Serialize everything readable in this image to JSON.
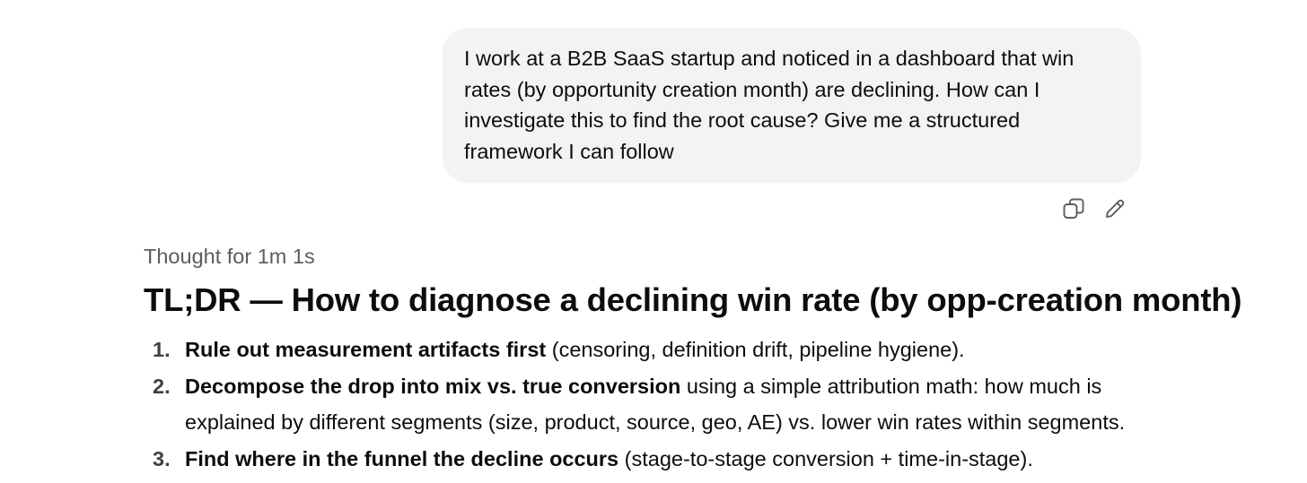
{
  "user_message": {
    "lines": [
      "I work at a B2B SaaS startup and noticed in a dashboard that win",
      "rates (by opportunity creation month) are declining. How can I",
      "investigate this to find the root cause? Give me a structured",
      "framework I can follow"
    ]
  },
  "message_actions": {
    "copy_icon": "copy-icon",
    "edit_icon": "edit-pencil-icon"
  },
  "assistant": {
    "thought_label": "Thought for 1m 1s",
    "heading": "TL;DR — How to diagnose a declining win rate (by opp-creation month)",
    "steps": [
      {
        "number": "1.",
        "bold": "Rule out measurement artifacts first",
        "rest_lines": [
          " (censoring, definition drift, pipeline hygiene)."
        ]
      },
      {
        "number": "2.",
        "bold": "Decompose the drop into mix vs. true conversion",
        "rest_lines": [
          " using a simple attribution math: how much is",
          "explained by different segments (size, product, source, geo, AE) vs. lower win rates within segments."
        ]
      },
      {
        "number": "3.",
        "bold": "Find where in the funnel the decline occurs",
        "rest_lines": [
          " (stage-to-stage conversion + time-in-stage)."
        ]
      }
    ]
  }
}
